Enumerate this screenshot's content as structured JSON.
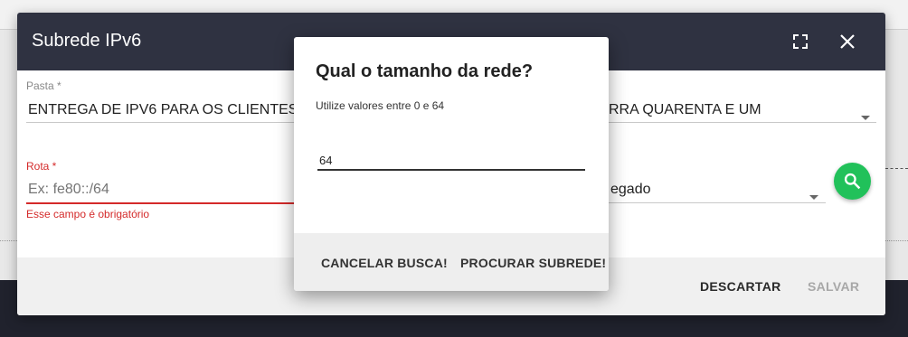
{
  "main_dialog": {
    "title": "Subrede IPv6",
    "fields": {
      "pasta": {
        "label": "Pasta *",
        "value": "ENTREGA DE IPV6 PARA OS CLIENTES"
      },
      "right_select_1": {
        "value": "RRA QUARENTA E UM"
      },
      "rota": {
        "label": "Rota *",
        "placeholder": "Ex: fe80::/64",
        "error": "Esse campo é obrigatório"
      },
      "right_select_2": {
        "value": "egado"
      }
    },
    "actions": {
      "discard": "DESCARTAR",
      "save": "SALVAR"
    }
  },
  "prompt_dialog": {
    "title": "Qual o tamanho da rede?",
    "hint": "Utilize valores entre 0 e 64",
    "input_value": "64",
    "actions": {
      "cancel": "CANCELAR BUSCA!",
      "search": "PROCURAR SUBREDE!"
    }
  },
  "icons": {
    "fullscreen": "fullscreen-icon",
    "close": "close-icon",
    "dropdown": "arrow-drop-down-icon",
    "search": "search-icon"
  },
  "colors": {
    "header_bg": "#2f3241",
    "error": "#d42a2a",
    "fab": "#21c15a",
    "footer_bg": "#20222d"
  }
}
